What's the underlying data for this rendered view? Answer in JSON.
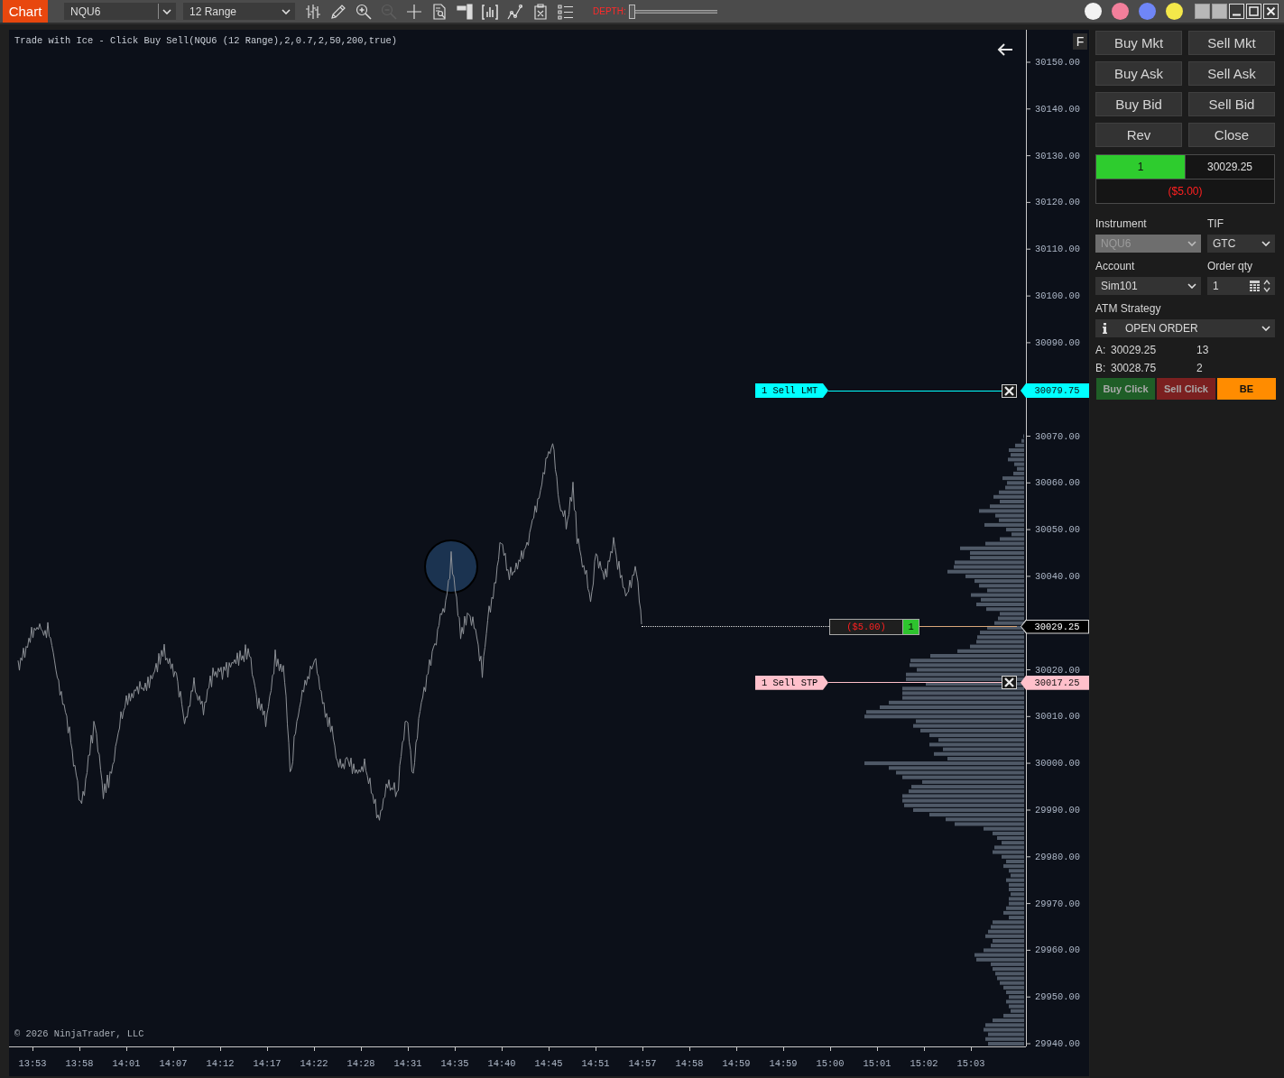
{
  "toolbar": {
    "tab": "Chart",
    "instrument": "NQU6",
    "interval": "12 Range",
    "tools": [
      {
        "kind": "ohlc",
        "disabled": false
      },
      {
        "kind": "pencil",
        "disabled": false
      },
      {
        "kind": "zoom-in",
        "disabled": false
      },
      {
        "kind": "zoom-out",
        "disabled": true
      },
      {
        "kind": "crosshair",
        "disabled": false
      },
      {
        "kind": "document-search",
        "disabled": false
      },
      {
        "kind": "data-box",
        "disabled": false
      },
      {
        "kind": "bar-chart",
        "disabled": false
      },
      {
        "kind": "line-chart",
        "disabled": false
      },
      {
        "kind": "clipboard",
        "disabled": false
      },
      {
        "kind": "list",
        "disabled": false
      }
    ],
    "depth": {
      "label": "DEPTH:",
      "level": 0
    },
    "color_buttons": [
      {
        "color": "#f2f2f2"
      },
      {
        "color": "#f27f9b"
      },
      {
        "color": "#6f86f7"
      },
      {
        "color": "#f4e84a"
      }
    ]
  },
  "chart": {
    "title": "Trade with Ice - Click Buy Sell(NQU6 (12 Range),2,0.7,2,50,200,true)",
    "f_button": "F",
    "price_axis": [
      "30150.00",
      "30140.00",
      "30130.00",
      "30120.00",
      "30110.00",
      "30100.00",
      "30090.00",
      "30070.00",
      "30060.00",
      "30050.00",
      "30040.00",
      "30020.00",
      "30010.00",
      "30000.00",
      "29990.00",
      "29980.00",
      "29970.00",
      "29960.00",
      "29950.00",
      "29940.00"
    ],
    "orders": [
      {
        "label": "1 Sell LMT",
        "price": "30079.75",
        "color": "#00ffff"
      },
      {
        "label": "1 Sell STP",
        "price": "30017.25",
        "color": "#ffc0cb"
      }
    ],
    "position": {
      "pnl": "($5.00)",
      "quantity": "1",
      "price": "30029.25",
      "long": true,
      "loss": true
    },
    "copyright": "© 2026 NinjaTrader, LLC",
    "time_axis": [
      "13:53",
      "13:58",
      "14:01",
      "14:07",
      "14:12",
      "14:17",
      "14:22",
      "14:28",
      "14:31",
      "14:35",
      "14:40",
      "14:45",
      "14:51",
      "14:57",
      "14:58",
      "14:59",
      "14:59",
      "15:00",
      "15:01",
      "15:02",
      "15:03"
    ]
  },
  "trade_panel": {
    "buttons": [
      "Buy Mkt",
      "Sell Mkt",
      "Buy Ask",
      "Sell Ask",
      "Buy Bid",
      "Sell Bid",
      "Rev",
      "Close"
    ],
    "position_display": {
      "quantity": "1",
      "price": "30029.25",
      "pnl": "($5.00)",
      "long": true,
      "loss": true
    },
    "fields": [
      {
        "label": "Instrument",
        "kind": "select",
        "value": "NQU6",
        "disabled": true
      },
      {
        "label": "TIF",
        "kind": "select",
        "value": "GTC",
        "disabled": false
      },
      {
        "label": "Account",
        "kind": "select",
        "value": "Sim101",
        "disabled": false
      },
      {
        "label": "Order qty",
        "kind": "spinner",
        "value": "1",
        "disabled": false
      }
    ],
    "atm": {
      "label": "ATM Strategy",
      "value": "OPEN ORDER"
    },
    "quotes": [
      {
        "label": "A:",
        "price": "30029.25",
        "size": "13"
      },
      {
        "label": "B:",
        "price": "30028.75",
        "size": "2"
      }
    ],
    "click_buttons": [
      {
        "label": "Buy Click",
        "color": "#1f5e27"
      },
      {
        "label": "Sell Click",
        "color": "#7b2020"
      },
      {
        "label": "BE",
        "color": "#ff8c00"
      }
    ]
  }
}
